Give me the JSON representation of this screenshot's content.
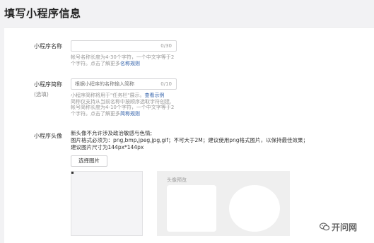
{
  "page": {
    "title": "填写小程序信息"
  },
  "form": {
    "name": {
      "label": "小程序名称",
      "placeholder": "",
      "counter": "0/30",
      "hint_line1": "帐号名称长度为4-30个字符，一个中文字等于2",
      "hint_line2_text": "个字符。点击了解更多",
      "hint_link": "名称规则"
    },
    "short_name": {
      "label": "小程序简称",
      "sublabel": "(选填)",
      "placeholder": "根据小程序的名称输入简称",
      "counter": "0/10",
      "hint_line1_text": "小程序简称将用于\"任务栏\"展示。",
      "hint_line1_link": "查看示例",
      "hint_line2": "简称仅支持从当前名称中按顺序选取字符创建,",
      "hint_line3": "帐号简称长度为4-10个字符，一个中文字等于2",
      "hint_line4_text": "个字符。点击了解更多",
      "hint_line4_link": "简称规则"
    },
    "avatar": {
      "label": "小程序头像",
      "req_line1": "新头像不允许涉及政治敏感与色情;",
      "req_line2": "图片格式必须为：png,bmp,jpeg,jpg,gif；不可大于2M；建议使用png格式图片，以保持最佳效果；",
      "req_line3": "建议图片尺寸为144px*144px",
      "choose_button": "选择图片",
      "preview_label": "头像预览"
    }
  },
  "watermark": {
    "text": "开问网",
    "icon": "wechat-icon"
  },
  "colors": {
    "link": "#2f5fa9",
    "background": "#f2f2f4",
    "card": "#ffffff"
  }
}
